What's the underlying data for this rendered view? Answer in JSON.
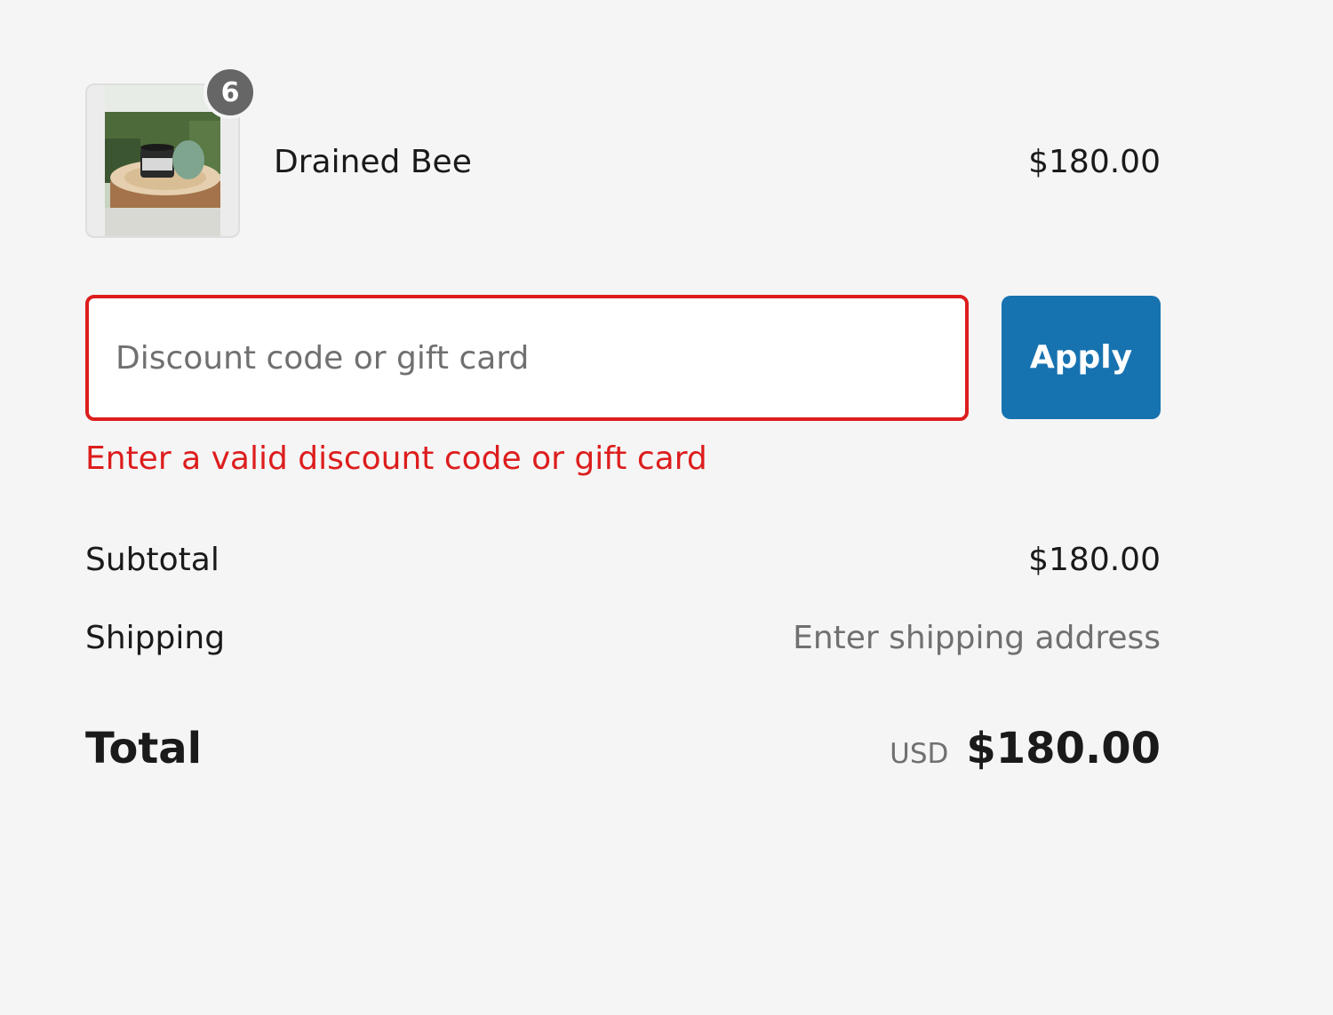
{
  "product": {
    "name": "Drained Bee",
    "price": "$180.00",
    "quantity": "6",
    "image_icon": "candle-photo-icon"
  },
  "discount": {
    "placeholder": "Discount code or gift card",
    "value": "",
    "apply_label": "Apply",
    "error": "Enter a valid discount code or gift card"
  },
  "summary": {
    "subtotal_label": "Subtotal",
    "subtotal_value": "$180.00",
    "shipping_label": "Shipping",
    "shipping_value": "Enter shipping address",
    "total_label": "Total",
    "currency": "USD",
    "total_value": "$180.00"
  },
  "colors": {
    "accent": "#1773b0",
    "error": "#dd1d1d",
    "badge": "#666666",
    "background": "#f5f5f5"
  }
}
